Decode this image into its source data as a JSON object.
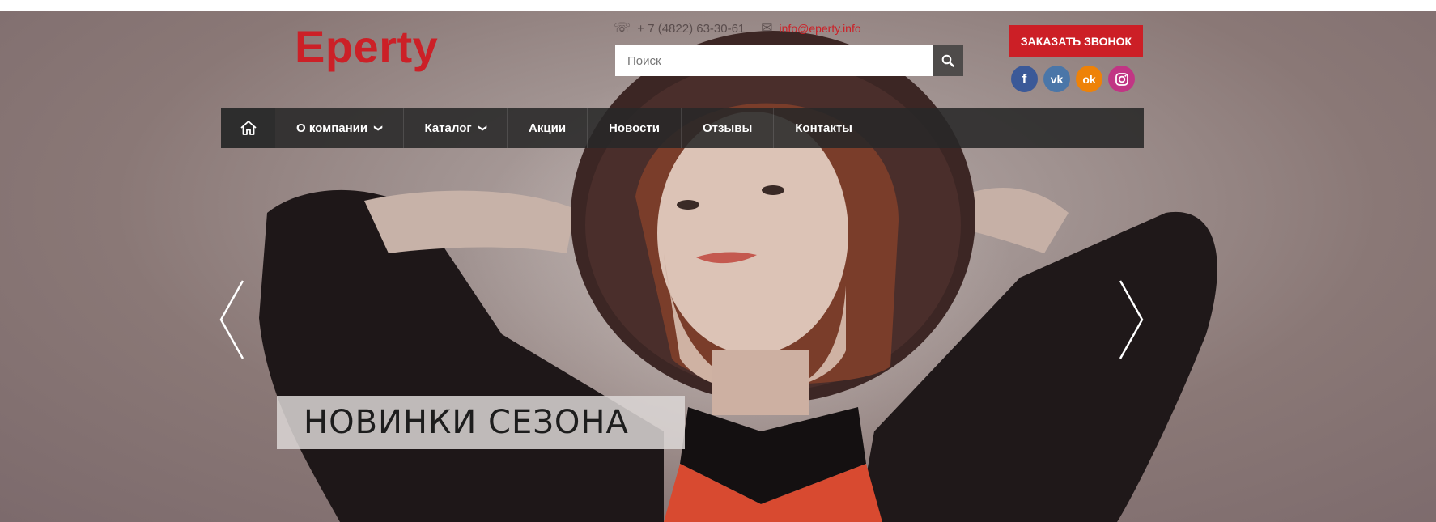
{
  "header": {
    "logo": "Eperty",
    "phone": "+ 7 (4822) 63-30-61",
    "email": "info@eperty.info",
    "search_placeholder": "Поиск",
    "callback_label": "ЗАКАЗАТЬ ЗВОНОК",
    "socials": [
      {
        "name": "facebook",
        "glyph": "f",
        "color": "#3b5998"
      },
      {
        "name": "vkontakte",
        "glyph": "vk",
        "color": "#4a76a8"
      },
      {
        "name": "odnoklassniki",
        "glyph": "ok",
        "color": "#ee8208"
      },
      {
        "name": "instagram",
        "glyph": "ig",
        "color": "#c13584"
      }
    ]
  },
  "nav": {
    "home_icon": "home-icon",
    "items": [
      {
        "label": "О компании",
        "dropdown": true
      },
      {
        "label": "Каталог",
        "dropdown": true
      },
      {
        "label": "Акции",
        "dropdown": false
      },
      {
        "label": "Новости",
        "dropdown": false
      },
      {
        "label": "Отзывы",
        "dropdown": false
      },
      {
        "label": "Контакты",
        "dropdown": false
      }
    ]
  },
  "slider": {
    "caption": "НОВИНКИ СЕЗОНА",
    "prev_icon": "chevron-left-icon",
    "next_icon": "chevron-right-icon"
  },
  "colors": {
    "accent": "#cc1f26",
    "nav_bg": "#2d2d2d"
  }
}
